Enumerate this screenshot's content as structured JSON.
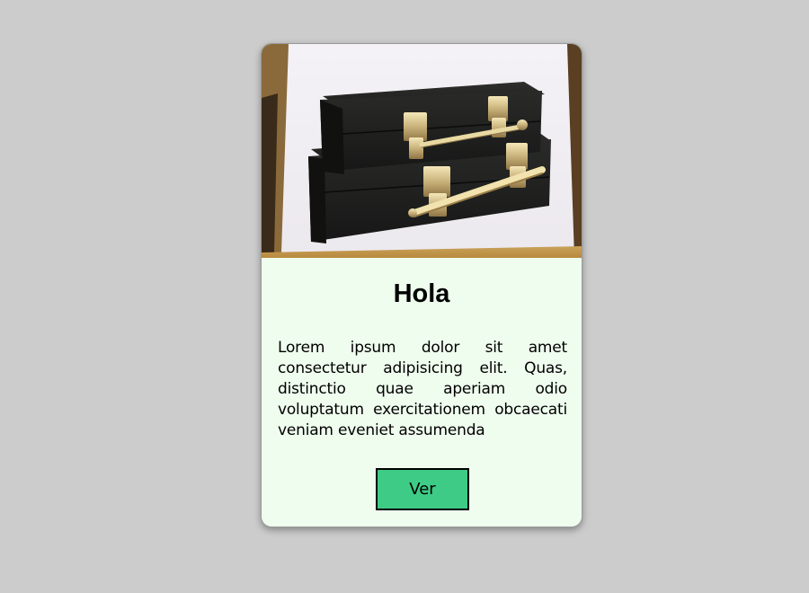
{
  "card": {
    "image": {
      "alt": "Two stacked black cases with brass latches and handles",
      "icon": "product-photo"
    },
    "title": "Hola",
    "description": "Lorem ipsum dolor sit amet consectetur adipisicing elit. Quas, distinctio quae aperiam odio voluptatum exercitationem obcaecati veniam eveniet assumenda",
    "button_label": "Ver"
  },
  "colors": {
    "page_background": "#cccccc",
    "card_background": "#effdee",
    "button_background": "#3ecb86",
    "button_border": "#000000"
  }
}
